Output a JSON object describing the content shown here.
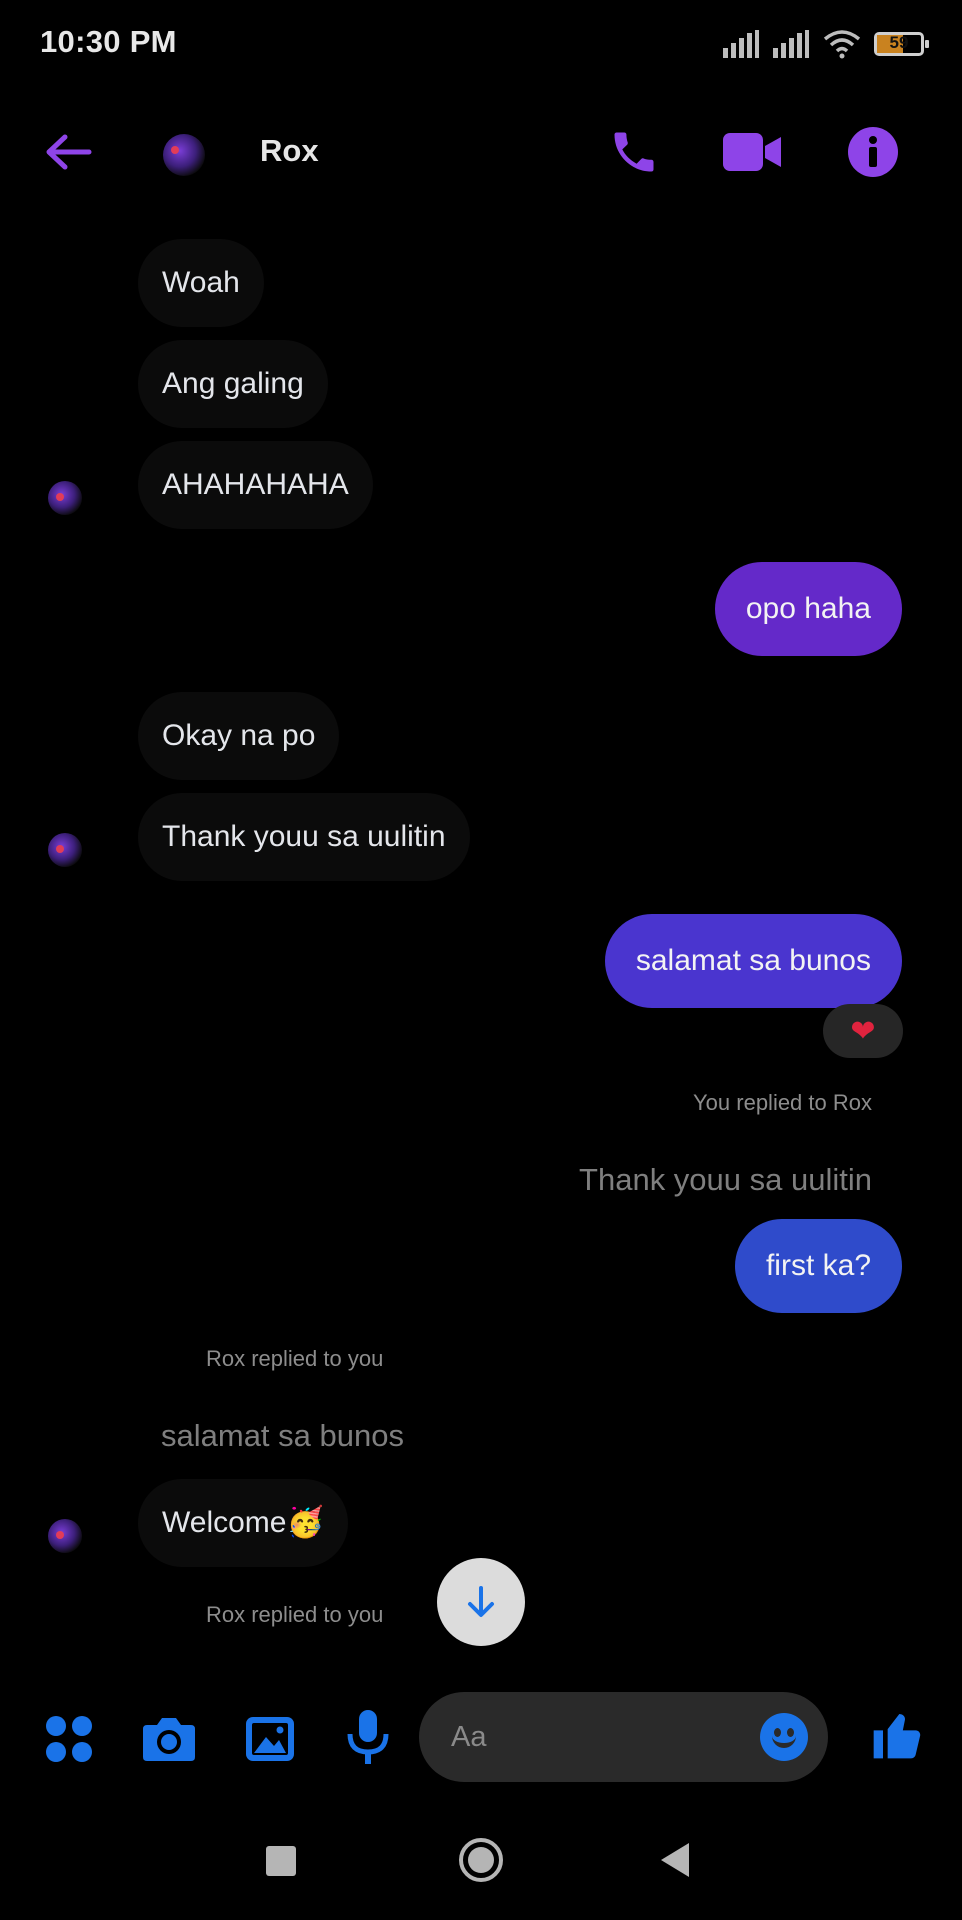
{
  "status_bar": {
    "time": "10:30 PM",
    "battery_level": "59",
    "icons": [
      "signal-icon",
      "signal-icon",
      "wifi-icon",
      "battery-icon"
    ]
  },
  "header": {
    "contact_name": "Rox",
    "back_icon": "arrow-left-icon",
    "actions": [
      "phone-icon",
      "video-camera-icon",
      "info-icon"
    ]
  },
  "messages": [
    {
      "from": "them",
      "text": "Woah"
    },
    {
      "from": "them",
      "text": "Ang galing"
    },
    {
      "from": "them",
      "text": "AHAHAHAHA"
    },
    {
      "from": "me",
      "text": "opo haha"
    },
    {
      "from": "them",
      "text": "Okay na po"
    },
    {
      "from": "them",
      "text": "Thank youu sa uulitin"
    },
    {
      "from": "me",
      "text": "salamat sa bunos",
      "reaction": "❤"
    },
    {
      "from": "me",
      "reply_label": "You replied to Rox",
      "quoted": "Thank youu sa uulitin",
      "text": "first ka?"
    },
    {
      "from": "them",
      "reply_label": "Rox replied to you",
      "quoted": "salamat sa bunos",
      "text": "Welcome🥳"
    },
    {
      "from": "them",
      "reply_label": "Rox replied to you"
    }
  ],
  "composer": {
    "placeholder": "Aa",
    "tools": [
      "menu-dots-icon",
      "camera-icon",
      "gallery-icon",
      "microphone-icon"
    ],
    "emoji_icon": "smiley-icon",
    "send_icon": "thumbs-up-icon"
  },
  "nav_bar": [
    "recents-square-icon",
    "home-circle-icon",
    "back-triangle-icon"
  ],
  "colors": {
    "accent_purple": "#8e44e8",
    "accent_blue": "#1a73e8",
    "bubble_purple": "#6429c9",
    "bubble_indigo": "#4a35cf",
    "bubble_blue": "#2f4bcb",
    "incoming_bubble": "#0b0b0b"
  }
}
